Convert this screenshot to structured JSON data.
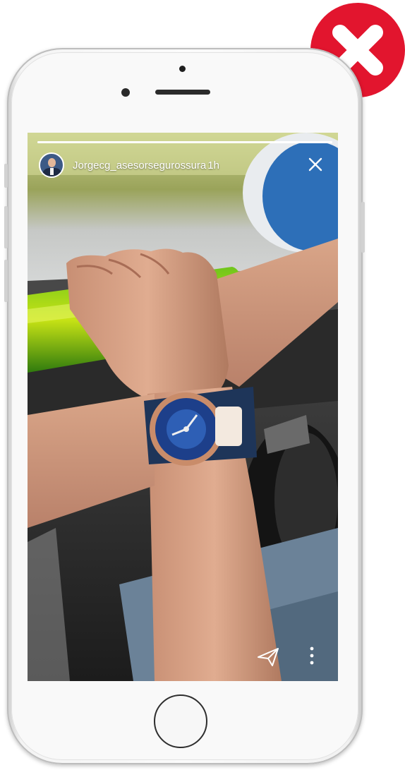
{
  "story": {
    "username": "Jorgecg_asesorsegurossura",
    "time_ago": "1h",
    "progress_fraction": 1.0
  },
  "icons": {
    "close": "close-icon",
    "send": "send-icon",
    "more": "more-options-icon",
    "badge": "red-x-icon"
  },
  "colors": {
    "badge_red": "#e2152e",
    "text": "#ffffff"
  }
}
